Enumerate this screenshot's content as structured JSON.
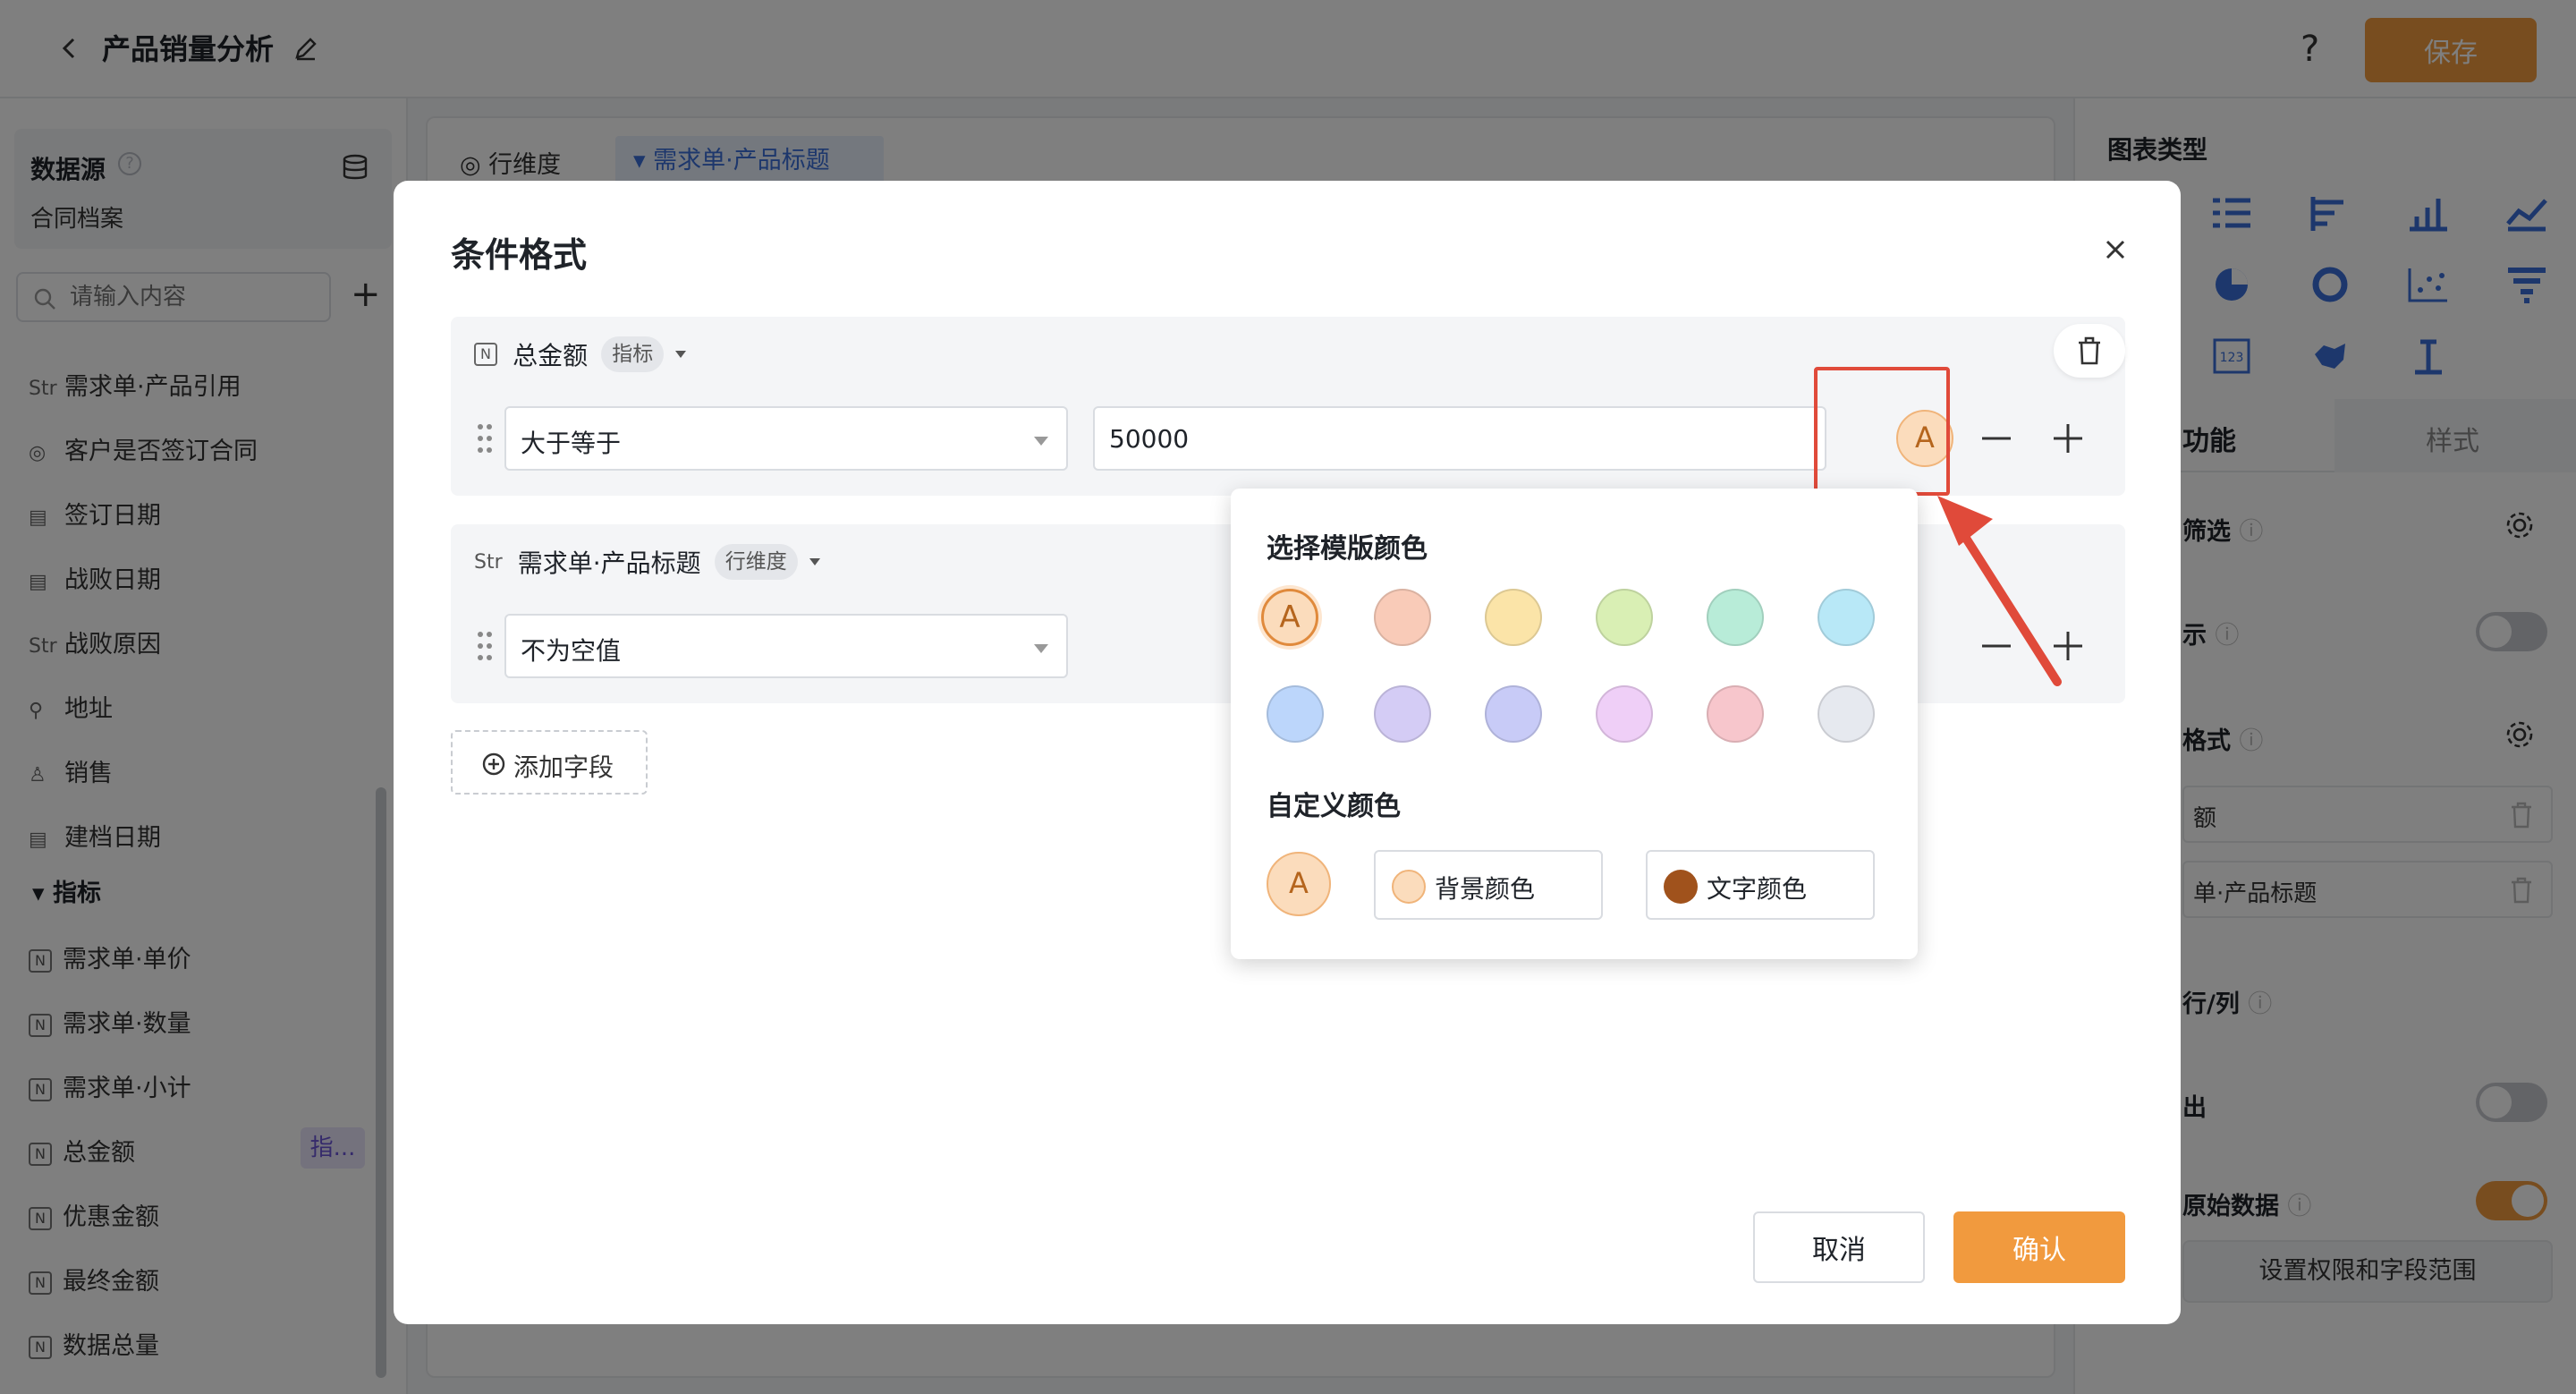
{
  "header": {
    "title": "产品销量分析",
    "help": "?",
    "save_label": "保存"
  },
  "left": {
    "datasource_title": "数据源",
    "datasource_help": "?",
    "datasource_name": "合同档案",
    "search_placeholder": "请输入内容",
    "add": "+",
    "fields": [
      {
        "type": "Str",
        "label": "需求单·产品引用"
      },
      {
        "type": "◎",
        "label": "客户是否签订合同"
      },
      {
        "type": "▤",
        "label": "签订日期"
      },
      {
        "type": "▤",
        "label": "战败日期"
      },
      {
        "type": "Str",
        "label": "战败原因"
      },
      {
        "type": "⚲",
        "label": "地址"
      },
      {
        "type": "♙",
        "label": "销售"
      },
      {
        "type": "▤",
        "label": "建档日期"
      }
    ],
    "metric_group": "指标",
    "metrics": [
      {
        "type": "N",
        "label": "需求单·单价"
      },
      {
        "type": "N",
        "label": "需求单·数量"
      },
      {
        "type": "N",
        "label": "需求单·小计"
      },
      {
        "type": "N",
        "label": "总金额",
        "badge": "指..."
      },
      {
        "type": "N",
        "label": "优惠金额"
      },
      {
        "type": "N",
        "label": "最终金额"
      },
      {
        "type": "N",
        "label": "数据总量"
      }
    ]
  },
  "center": {
    "row_dim_label": "行维度",
    "row_dim_tag": "需求单·产品标题"
  },
  "right": {
    "chart_type_title": "图表类型",
    "tab_func": "功能",
    "tab_style": "样式",
    "rows": [
      "筛选",
      "示",
      "格式",
      "行/列",
      "出",
      "原始数据"
    ],
    "cond_fields": [
      "额",
      "单·产品标题"
    ],
    "perm_button": "设置权限和字段范围"
  },
  "modal": {
    "title": "条件格式",
    "card1": {
      "type": "N",
      "field": "总金额",
      "tag": "指标",
      "operator": "大于等于",
      "value": "50000",
      "color_letter": "A"
    },
    "card2": {
      "type": "Str",
      "field": "需求单·产品标题",
      "tag": "行维度",
      "operator": "不为空值"
    },
    "add_field": "添加字段",
    "cancel": "取消",
    "confirm": "确认"
  },
  "popover": {
    "template_title": "选择模版颜色",
    "selected_letter": "A",
    "swatches": [
      "#fbdcbc",
      "#f9cbb8",
      "#fbe4a8",
      "#d9efb4",
      "#b8ecd8",
      "#b8e8f7",
      "#bcd6fb",
      "#d4ccf5",
      "#c8cbf7",
      "#efcff7",
      "#f7c6cc",
      "#e6e9ef"
    ],
    "custom_title": "自定义颜色",
    "preview_letter": "A",
    "bg_color_label": "背景颜色",
    "bg_color": "#fbdcbc",
    "text_color_label": "文字颜色",
    "text_color": "#a0521c"
  },
  "colors": {
    "accent": "#f19a3e",
    "highlight": "#e04a3a"
  }
}
